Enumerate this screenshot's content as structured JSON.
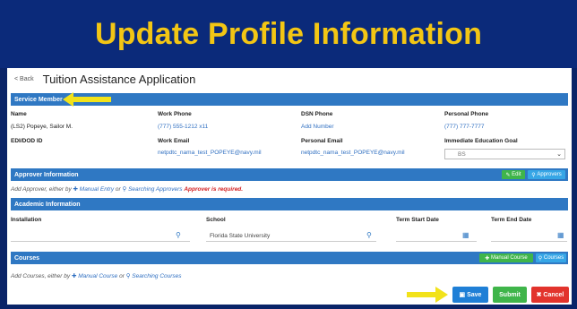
{
  "banner": {
    "title": "Update Profile Information"
  },
  "topbar": {
    "back": "< Back",
    "title": "Tuition Assistance Application"
  },
  "service_member": {
    "header": "Service Member",
    "fields": {
      "name": {
        "label": "Name",
        "value": "(LS2) Popeye, Sailor M."
      },
      "work_phone": {
        "label": "Work Phone",
        "value": "(777) 555-1212 x11"
      },
      "dsn_phone": {
        "label": "DSN Phone",
        "value": "Add Number"
      },
      "personal_phone": {
        "label": "Personal Phone",
        "value": "(777) 777-7777"
      },
      "edipi": {
        "label": "EDI/DOD ID",
        "value": ""
      },
      "work_email": {
        "label": "Work Email",
        "value": "netpdtc_nama_test_POPEYE@navy.mil"
      },
      "personal_email": {
        "label": "Personal Email",
        "value": "netpdtc_nama_test_POPEYE@navy.mil"
      },
      "edu_goal": {
        "label": "Immediate Education Goal",
        "value": "BS"
      }
    }
  },
  "approver": {
    "header": "Approver Information",
    "edit_label": "Edit",
    "approvers_label": "Approvers",
    "add_text": "Add Approver, either by",
    "manual_entry": "Manual Entry",
    "or": "or",
    "searching": "Searching Approvers",
    "required": "Approver is required."
  },
  "academic": {
    "header": "Academic Information",
    "installation_label": "Installation",
    "school_label": "School",
    "school_value": "Florida State University",
    "term_start_label": "Term Start Date",
    "term_end_label": "Term End Date"
  },
  "courses": {
    "header": "Courses",
    "manual_course": "Manual Course",
    "courses_btn": "Courses",
    "add_text": "Add Courses, either by",
    "manual": "Manual Course",
    "or": "or",
    "searching": "Searching Courses"
  },
  "actions": {
    "save": "Save",
    "submit": "Submit",
    "cancel": "Cancel"
  },
  "colors": {
    "banner_bg": "#0b2a7a",
    "banner_text": "#f3c614",
    "section_bar": "#2f78c3",
    "arrow": "#f2e21a"
  }
}
